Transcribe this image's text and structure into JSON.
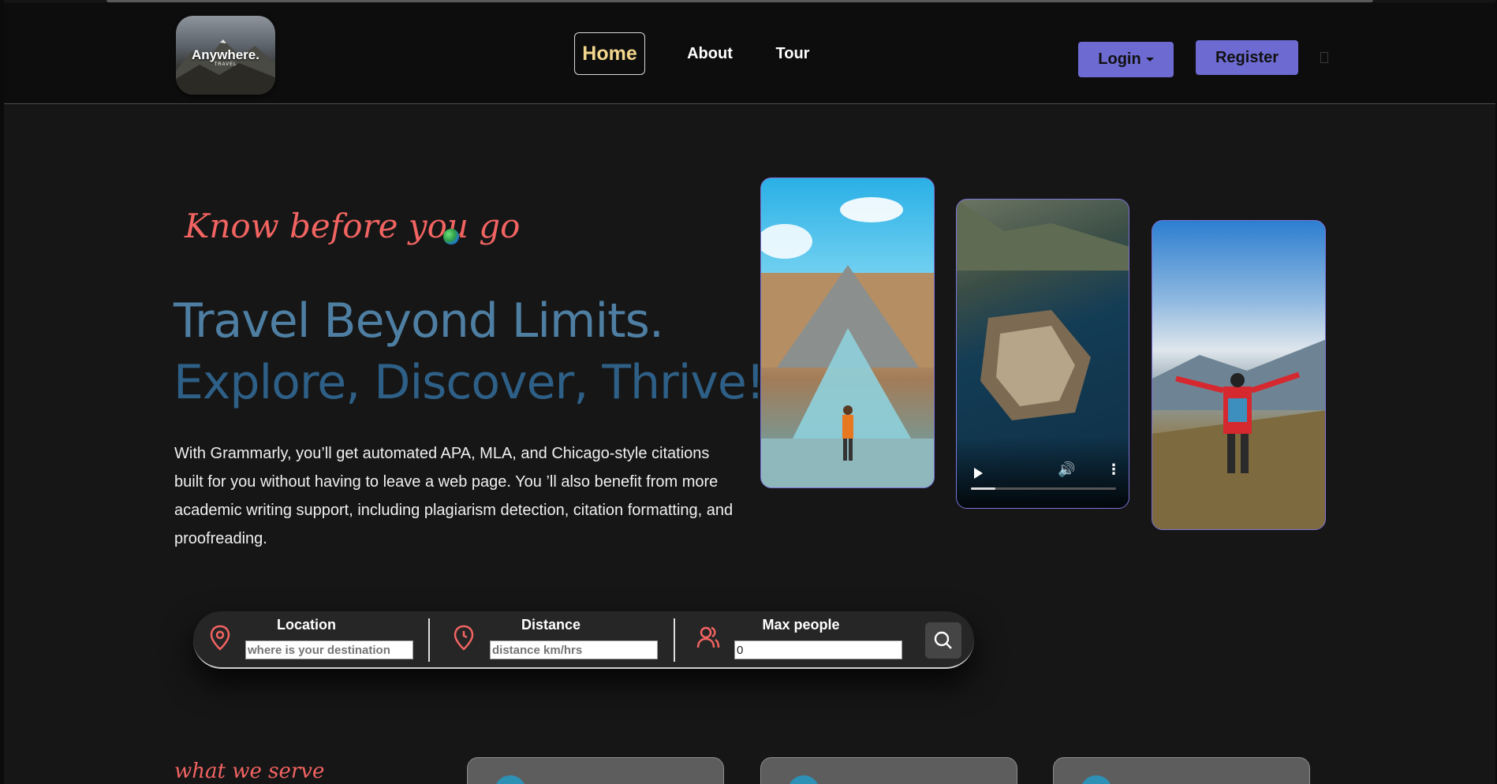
{
  "header": {
    "logo": {
      "name": "Anywhere.",
      "sub": "TRAVEL"
    },
    "nav": [
      {
        "label": "Home",
        "active": true
      },
      {
        "label": "About"
      },
      {
        "label": "Tour"
      }
    ],
    "login_label": "Login",
    "register_label": "Register"
  },
  "hero": {
    "tagline": "Know before you go",
    "headline_1": "Travel Beyond Limits.",
    "headline_2": "Explore, Discover, Thrive!",
    "intro": "With Grammarly, you’ll get automated APA, MLA, and Chicago-style citations built for you without having to leave a web page. You ’ll also benefit from more academic writing support, including plagiarism detection, citation formatting, and proofreading.",
    "video_progress": 0.17
  },
  "search": {
    "location": {
      "label": "Location",
      "placeholder": "where is your destination"
    },
    "distance": {
      "label": "Distance",
      "placeholder": "distance km/hrs"
    },
    "people": {
      "label": "Max people",
      "value": "0"
    }
  },
  "services": {
    "heading": "what we serve"
  },
  "colors": {
    "accent": "#6d6bd2",
    "tagline": "#f26462",
    "active_nav": "#f2d68c",
    "headline_1": "#4e7fa3",
    "headline_2": "#2e5f86"
  }
}
